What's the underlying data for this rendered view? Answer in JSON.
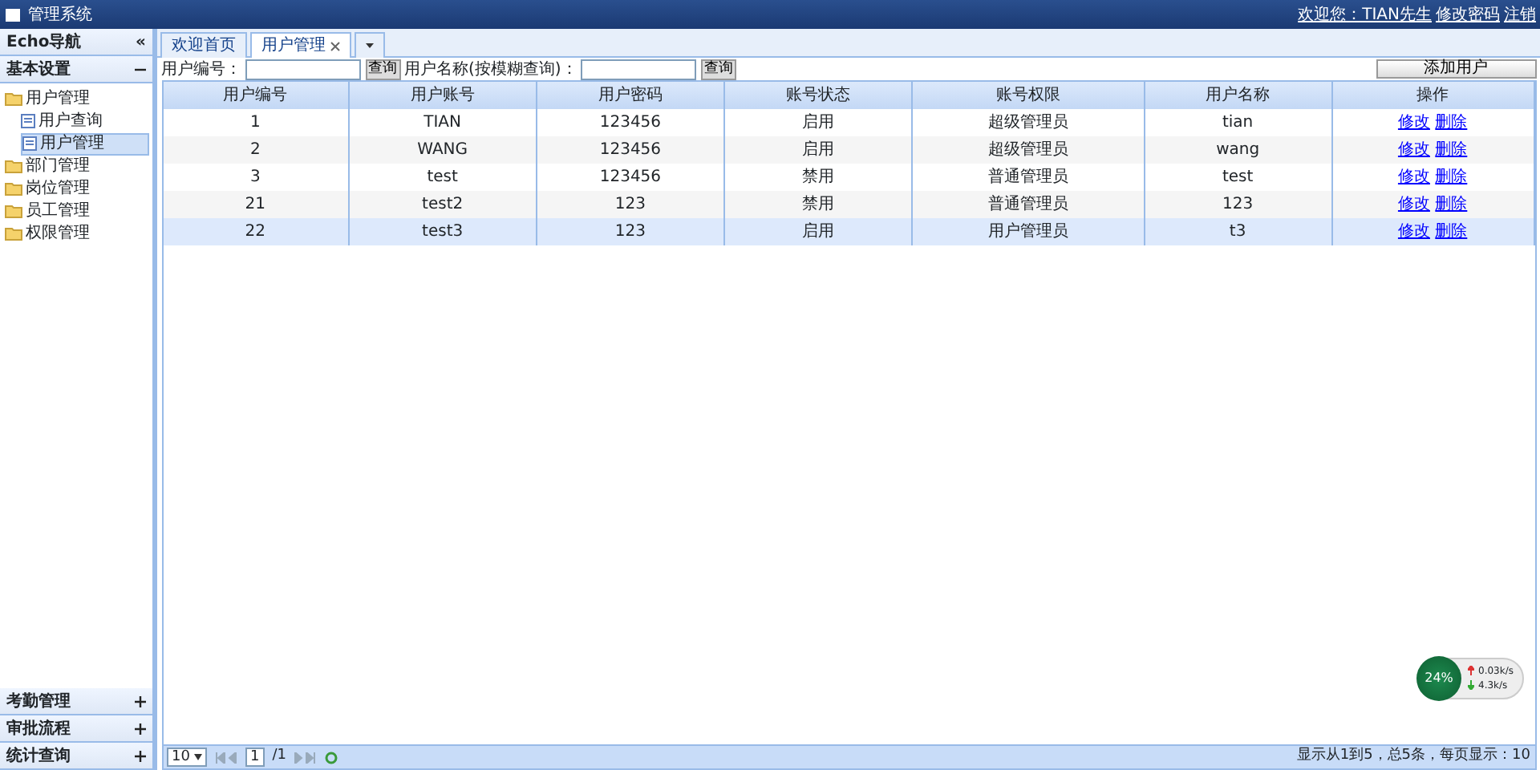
{
  "app": {
    "title": "管理系统",
    "header_links": [
      "欢迎您：TIAN先生",
      "修改密码",
      "注销"
    ]
  },
  "sidebar": {
    "title": "Echo导航",
    "collapse": "«",
    "panels_top": [
      {
        "label": "基本设置",
        "expanded": true
      }
    ],
    "tree": [
      {
        "label": "用户管理",
        "children": [
          {
            "label": "用户查询",
            "selected": false
          },
          {
            "label": "用户管理",
            "selected": true
          }
        ]
      },
      {
        "label": "部门管理"
      },
      {
        "label": "岗位管理"
      },
      {
        "label": "员工管理"
      },
      {
        "label": "权限管理"
      }
    ],
    "panels_bottom": [
      {
        "label": "考勤管理",
        "expanded": false
      },
      {
        "label": "审批流程",
        "expanded": false
      },
      {
        "label": "统计查询",
        "expanded": false
      }
    ]
  },
  "tabs": [
    {
      "label": "欢迎首页",
      "selected": false,
      "closable": false
    },
    {
      "label": "用户管理",
      "selected": true,
      "closable": true
    }
  ],
  "filters": [
    {
      "label": "用户编号：",
      "button": "查询"
    },
    {
      "label": "用户名称(按模糊查询)：",
      "button": "查询"
    }
  ],
  "add_button": "添加用户",
  "table": {
    "columns": [
      "用户编号",
      "用户账号",
      "用户密码",
      "账号状态",
      "账号权限",
      "用户名称",
      "操作"
    ],
    "rows": [
      {
        "cells": [
          "1",
          "TIAN",
          "123456",
          "启用",
          "超级管理员",
          "tian"
        ],
        "actions": [
          "修改",
          "删除"
        ],
        "selected": false
      },
      {
        "cells": [
          "2",
          "WANG",
          "123456",
          "启用",
          "超级管理员",
          "wang"
        ],
        "actions": [
          "修改",
          "删除"
        ],
        "selected": false
      },
      {
        "cells": [
          "3",
          "test",
          "123456",
          "禁用",
          "普通管理员",
          "test"
        ],
        "actions": [
          "修改",
          "删除"
        ],
        "selected": false
      },
      {
        "cells": [
          "21",
          "test2",
          "123",
          "禁用",
          "普通管理员",
          "123"
        ],
        "actions": [
          "修改",
          "删除"
        ],
        "selected": false
      },
      {
        "cells": [
          "22",
          "test3",
          "123",
          "启用",
          "用户管理员",
          "t3"
        ],
        "actions": [
          "修改",
          "删除"
        ],
        "selected": true
      }
    ]
  },
  "pager": {
    "page_size": "10",
    "page": "1",
    "pages": "/1",
    "info": "显示从1到5，总5条，每页显示：10"
  },
  "net_widget": {
    "percent": "24%",
    "up": "0.03k/s",
    "down": "4.3k/s"
  }
}
